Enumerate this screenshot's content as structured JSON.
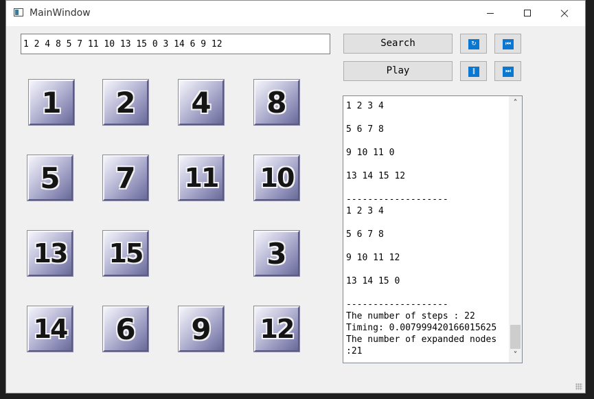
{
  "window": {
    "title": "MainWindow"
  },
  "controls": {
    "sequence_input_value": "1 2 4 8 5 7 11 10 13 15 0 3 14 6 9 12",
    "search_label": "Search",
    "play_label": "Play",
    "refresh_icon": "refresh-icon",
    "first_icon": "skip-to-start-icon",
    "pause_icon": "pause-icon",
    "last_icon": "skip-to-end-icon",
    "accent_color": "#0a78d0"
  },
  "board": {
    "tiles": [
      "1",
      "2",
      "4",
      "8",
      "5",
      "7",
      "11",
      "10",
      "13",
      "15",
      "",
      "3",
      "14",
      "6",
      "9",
      "12"
    ]
  },
  "output": {
    "text": "-------------------\n1 2 3 4\n\n5 6 7 8\n\n9 10 11 0\n\n13 14 15 12\n\n-------------------\n1 2 3 4\n\n5 6 7 8\n\n9 10 11 12\n\n13 14 15 0\n\n-------------------\nThe number of steps : 22\nTiming: 0.007999420166015625\nThe number of expanded nodes\n:21"
  }
}
